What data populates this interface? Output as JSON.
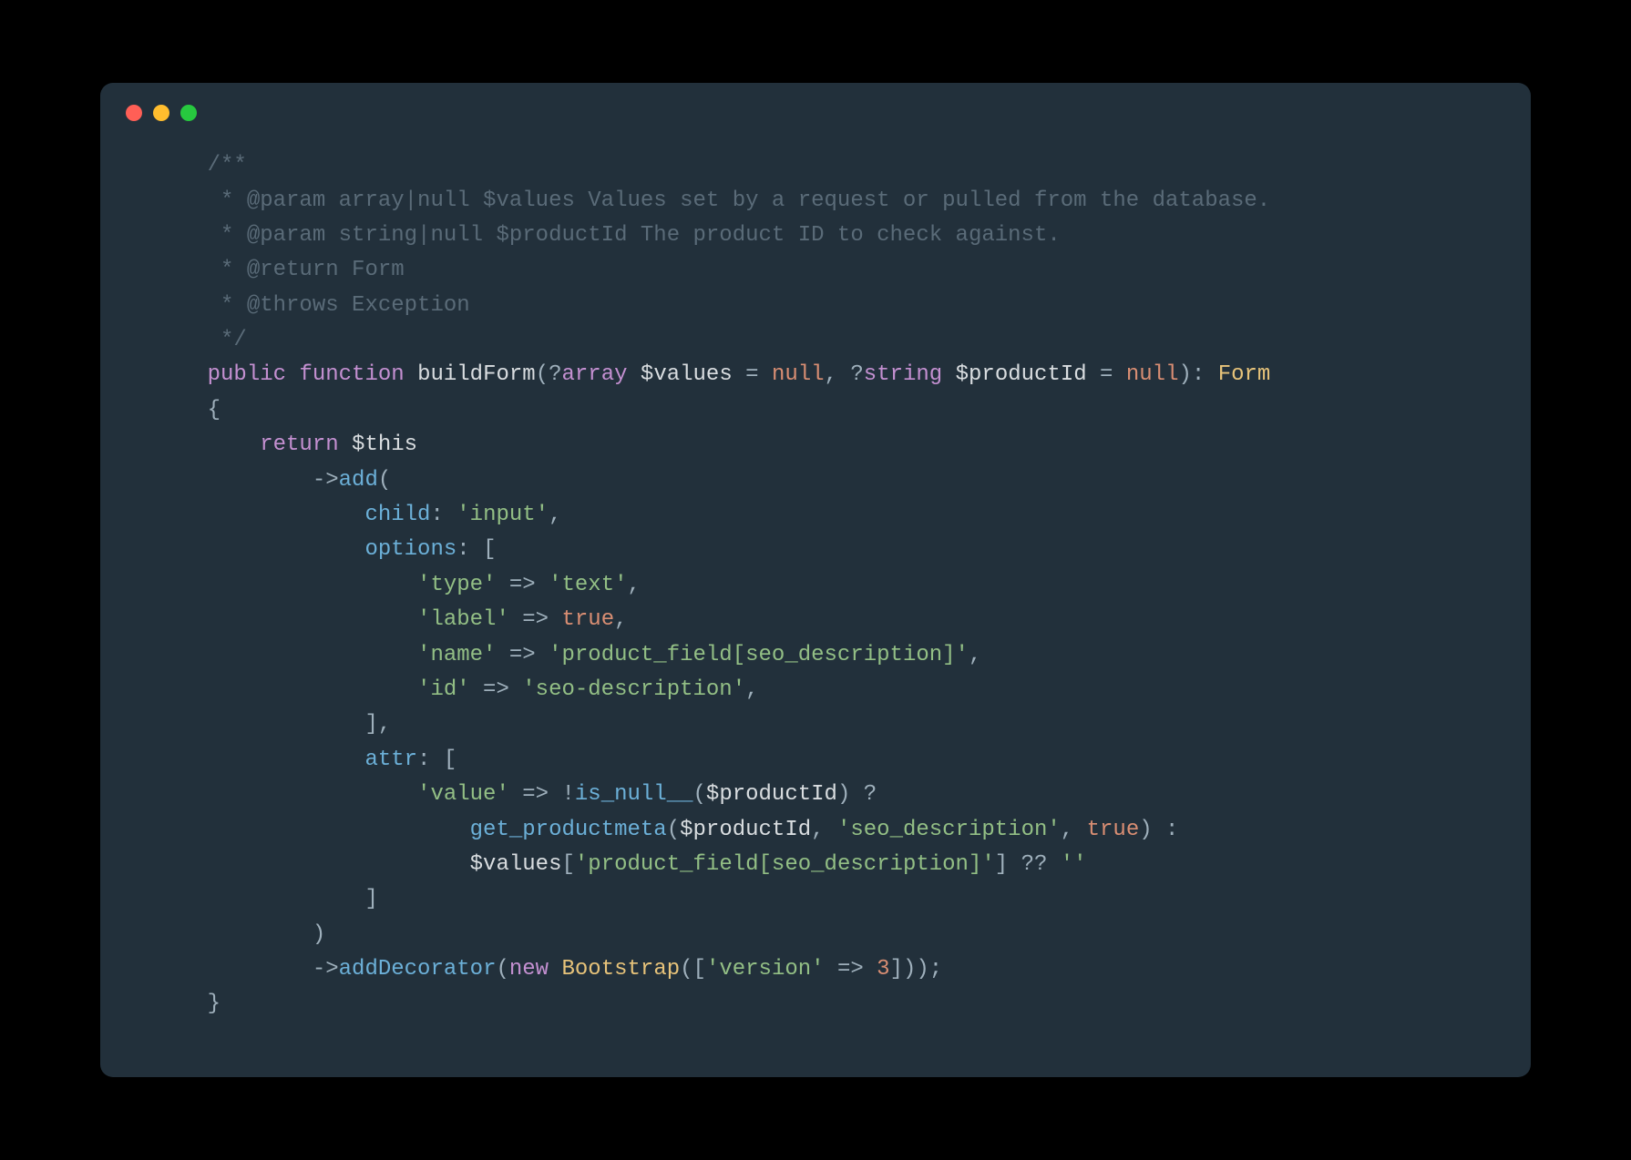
{
  "titlebar": {
    "close": "close",
    "minimize": "minimize",
    "zoom": "zoom"
  },
  "code": {
    "lines": [
      {
        "indent": 1,
        "tokens": [
          {
            "t": "comment",
            "v": "/**"
          }
        ]
      },
      {
        "indent": 1,
        "tokens": [
          {
            "t": "comment",
            "v": " * @param array|null $values Values set by a request or pulled from the database."
          }
        ]
      },
      {
        "indent": 1,
        "tokens": [
          {
            "t": "comment",
            "v": " * @param string|null $productId The product ID to check against."
          }
        ]
      },
      {
        "indent": 1,
        "tokens": [
          {
            "t": "comment",
            "v": " * @return Form"
          }
        ]
      },
      {
        "indent": 1,
        "tokens": [
          {
            "t": "comment",
            "v": " * @throws Exception"
          }
        ]
      },
      {
        "indent": 1,
        "tokens": [
          {
            "t": "comment",
            "v": " */"
          }
        ]
      },
      {
        "indent": 1,
        "tokens": [
          {
            "t": "keyword",
            "v": "public"
          },
          {
            "t": "punct",
            "v": " "
          },
          {
            "t": "keyword",
            "v": "function"
          },
          {
            "t": "punct",
            "v": " "
          },
          {
            "t": "func",
            "v": "buildForm"
          },
          {
            "t": "punct",
            "v": "("
          },
          {
            "t": "punct",
            "v": "?"
          },
          {
            "t": "type",
            "v": "array"
          },
          {
            "t": "punct",
            "v": " "
          },
          {
            "t": "dollar",
            "v": "$values"
          },
          {
            "t": "punct",
            "v": " = "
          },
          {
            "t": "bool",
            "v": "null"
          },
          {
            "t": "punct",
            "v": ", "
          },
          {
            "t": "punct",
            "v": "?"
          },
          {
            "t": "type",
            "v": "string"
          },
          {
            "t": "punct",
            "v": " "
          },
          {
            "t": "dollar",
            "v": "$productId"
          },
          {
            "t": "punct",
            "v": " = "
          },
          {
            "t": "bool",
            "v": "null"
          },
          {
            "t": "punct",
            "v": "): "
          },
          {
            "t": "class",
            "v": "Form"
          }
        ]
      },
      {
        "indent": 1,
        "tokens": [
          {
            "t": "punct",
            "v": "{"
          }
        ]
      },
      {
        "indent": 2,
        "tokens": [
          {
            "t": "keyword",
            "v": "return"
          },
          {
            "t": "punct",
            "v": " "
          },
          {
            "t": "dollar",
            "v": "$this"
          }
        ]
      },
      {
        "indent": 3,
        "tokens": [
          {
            "t": "punct",
            "v": "->"
          },
          {
            "t": "call",
            "v": "add"
          },
          {
            "t": "punct",
            "v": "("
          }
        ]
      },
      {
        "indent": 4,
        "tokens": [
          {
            "t": "name",
            "v": "child"
          },
          {
            "t": "punct",
            "v": ": "
          },
          {
            "t": "string",
            "v": "'input'"
          },
          {
            "t": "punct",
            "v": ","
          }
        ]
      },
      {
        "indent": 4,
        "tokens": [
          {
            "t": "name",
            "v": "options"
          },
          {
            "t": "punct",
            "v": ": ["
          }
        ]
      },
      {
        "indent": 5,
        "tokens": [
          {
            "t": "string",
            "v": "'type'"
          },
          {
            "t": "punct",
            "v": " => "
          },
          {
            "t": "string",
            "v": "'text'"
          },
          {
            "t": "punct",
            "v": ","
          }
        ]
      },
      {
        "indent": 5,
        "tokens": [
          {
            "t": "string",
            "v": "'label'"
          },
          {
            "t": "punct",
            "v": " => "
          },
          {
            "t": "bool",
            "v": "true"
          },
          {
            "t": "punct",
            "v": ","
          }
        ]
      },
      {
        "indent": 5,
        "tokens": [
          {
            "t": "string",
            "v": "'name'"
          },
          {
            "t": "punct",
            "v": " => "
          },
          {
            "t": "string",
            "v": "'product_field[seo_description]'"
          },
          {
            "t": "punct",
            "v": ","
          }
        ]
      },
      {
        "indent": 5,
        "tokens": [
          {
            "t": "string",
            "v": "'id'"
          },
          {
            "t": "punct",
            "v": " => "
          },
          {
            "t": "string",
            "v": "'seo-description'"
          },
          {
            "t": "punct",
            "v": ","
          }
        ]
      },
      {
        "indent": 4,
        "tokens": [
          {
            "t": "punct",
            "v": "],"
          }
        ]
      },
      {
        "indent": 4,
        "tokens": [
          {
            "t": "name",
            "v": "attr"
          },
          {
            "t": "punct",
            "v": ": ["
          }
        ]
      },
      {
        "indent": 5,
        "tokens": [
          {
            "t": "string",
            "v": "'value'"
          },
          {
            "t": "punct",
            "v": " => !"
          },
          {
            "t": "call",
            "v": "is_null__"
          },
          {
            "t": "punct",
            "v": "("
          },
          {
            "t": "dollar",
            "v": "$productId"
          },
          {
            "t": "punct",
            "v": ") ?"
          }
        ]
      },
      {
        "indent": 6,
        "tokens": [
          {
            "t": "call",
            "v": "get_productmeta"
          },
          {
            "t": "punct",
            "v": "("
          },
          {
            "t": "dollar",
            "v": "$productId"
          },
          {
            "t": "punct",
            "v": ", "
          },
          {
            "t": "string",
            "v": "'seo_description'"
          },
          {
            "t": "punct",
            "v": ", "
          },
          {
            "t": "bool",
            "v": "true"
          },
          {
            "t": "punct",
            "v": ") :"
          }
        ]
      },
      {
        "indent": 6,
        "tokens": [
          {
            "t": "dollar",
            "v": "$values"
          },
          {
            "t": "punct",
            "v": "["
          },
          {
            "t": "string",
            "v": "'product_field[seo_description]'"
          },
          {
            "t": "punct",
            "v": "] ?? "
          },
          {
            "t": "string",
            "v": "''"
          }
        ]
      },
      {
        "indent": 4,
        "tokens": [
          {
            "t": "punct",
            "v": "]"
          }
        ]
      },
      {
        "indent": 3,
        "tokens": [
          {
            "t": "punct",
            "v": ")"
          }
        ]
      },
      {
        "indent": 3,
        "tokens": [
          {
            "t": "punct",
            "v": "->"
          },
          {
            "t": "call",
            "v": "addDecorator"
          },
          {
            "t": "punct",
            "v": "("
          },
          {
            "t": "keyword",
            "v": "new"
          },
          {
            "t": "punct",
            "v": " "
          },
          {
            "t": "class",
            "v": "Bootstrap"
          },
          {
            "t": "punct",
            "v": "(["
          },
          {
            "t": "string",
            "v": "'version'"
          },
          {
            "t": "punct",
            "v": " => "
          },
          {
            "t": "num",
            "v": "3"
          },
          {
            "t": "punct",
            "v": "]));"
          }
        ]
      },
      {
        "indent": 1,
        "tokens": [
          {
            "t": "punct",
            "v": "}"
          }
        ]
      }
    ]
  }
}
